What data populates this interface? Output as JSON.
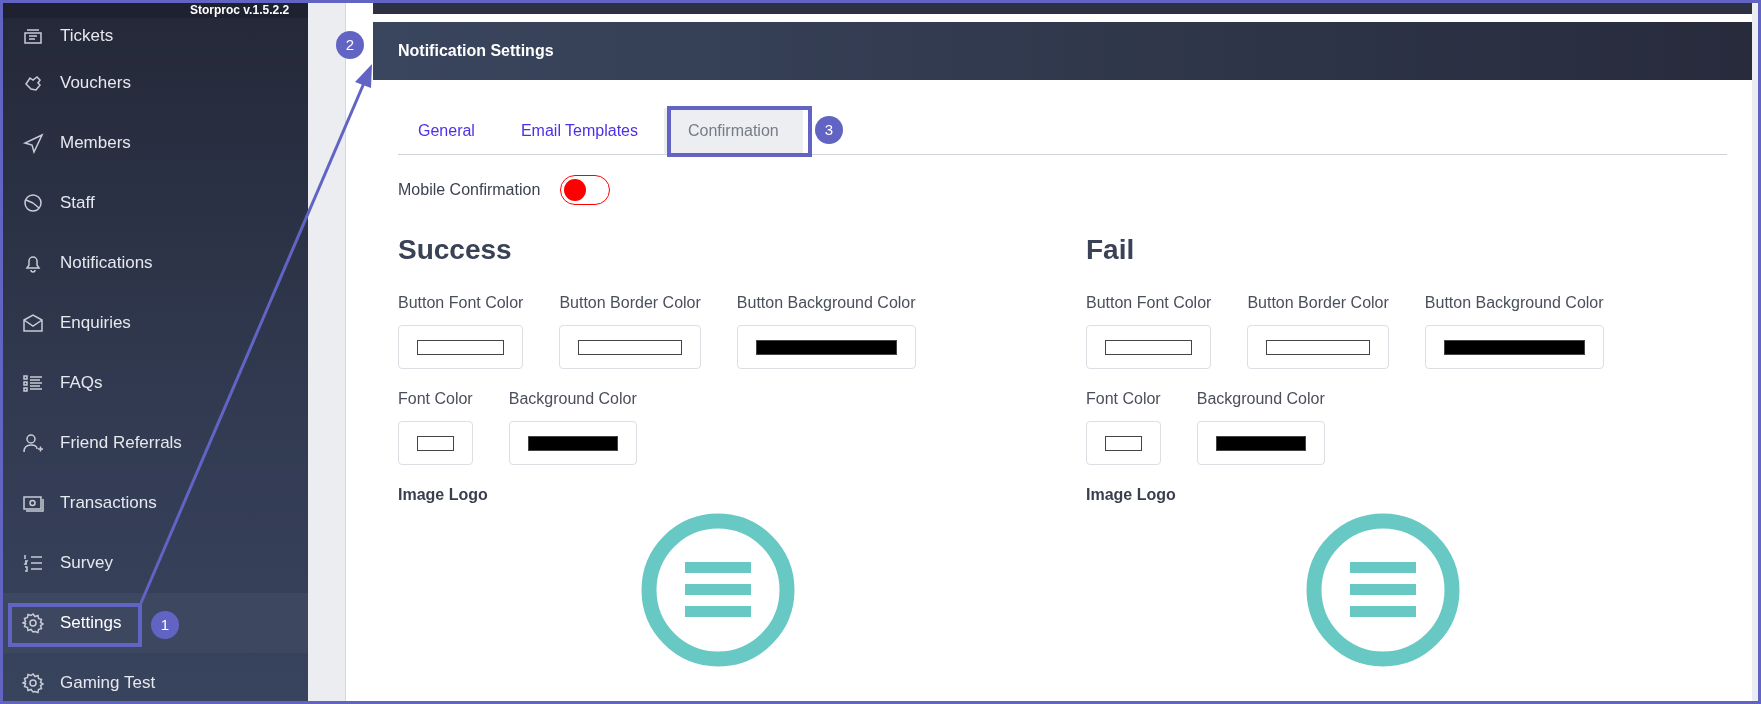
{
  "app": {
    "version": "Storproc v.1.5.2.2"
  },
  "sidebar": {
    "items": [
      {
        "label": "Tickets",
        "selected": false
      },
      {
        "label": "Vouchers",
        "selected": false
      },
      {
        "label": "Members",
        "selected": false
      },
      {
        "label": "Staff",
        "selected": false
      },
      {
        "label": "Notifications",
        "selected": false
      },
      {
        "label": "Enquiries",
        "selected": false
      },
      {
        "label": "FAQs",
        "selected": false
      },
      {
        "label": "Friend Referrals",
        "selected": false
      },
      {
        "label": "Transactions",
        "selected": false
      },
      {
        "label": "Survey",
        "selected": false
      },
      {
        "label": "Settings",
        "selected": true
      },
      {
        "label": "Gaming Test",
        "selected": false
      }
    ]
  },
  "panel": {
    "title": "Notification Settings",
    "tabs": [
      {
        "label": "General",
        "selected": false
      },
      {
        "label": "Email Templates",
        "selected": false
      },
      {
        "label": "Confirmation",
        "selected": true
      }
    ],
    "mobile_confirmation": {
      "label": "Mobile Confirmation",
      "on": false
    },
    "sections": [
      {
        "title": "Success",
        "button_fields": [
          {
            "label": "Button Font Color",
            "color": "#ffffff"
          },
          {
            "label": "Button Border Color",
            "color": "#ffffff"
          },
          {
            "label": "Button Background Color",
            "color": "#000000"
          }
        ],
        "fields": [
          {
            "label": "Font Color",
            "color": "#ffffff"
          },
          {
            "label": "Background Color",
            "color": "#000000"
          }
        ],
        "logo_label": "Image Logo"
      },
      {
        "title": "Fail",
        "button_fields": [
          {
            "label": "Button Font Color",
            "color": "#ffffff"
          },
          {
            "label": "Button Border Color",
            "color": "#ffffff"
          },
          {
            "label": "Button Background Color",
            "color": "#000000"
          }
        ],
        "fields": [
          {
            "label": "Font Color",
            "color": "#ffffff"
          },
          {
            "label": "Background Color",
            "color": "#000000"
          }
        ],
        "logo_label": "Image Logo"
      }
    ]
  },
  "annotations": [
    {
      "number": "1"
    },
    {
      "number": "2"
    },
    {
      "number": "3"
    }
  ]
}
